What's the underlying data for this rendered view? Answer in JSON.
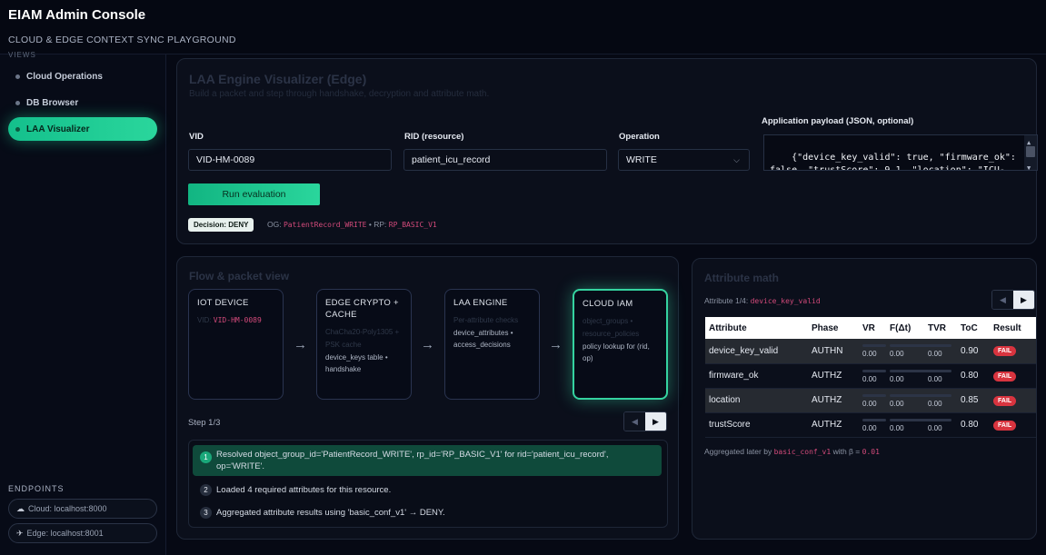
{
  "app": {
    "title": "EIAM Admin Console",
    "subtitle": "CLOUD & EDGE CONTEXT SYNC PLAYGROUND"
  },
  "sidebar": {
    "views_label": "VIEWS",
    "items": [
      {
        "label": "Cloud Operations"
      },
      {
        "label": "DB Browser"
      },
      {
        "label": "LAA Visualizer",
        "active": true
      }
    ],
    "endpoints_label": "ENDPOINTS",
    "endpoints": [
      {
        "icon": "cloud-icon",
        "glyph": "☁",
        "label": "Cloud: localhost:8000"
      },
      {
        "icon": "edge-icon",
        "glyph": "✈",
        "label": "Edge: localhost:8001"
      }
    ]
  },
  "engine": {
    "title": "LAA Engine Visualizer (Edge)",
    "subtitle": "Build a packet and step through handshake, decryption and attribute math.",
    "vid_label": "VID",
    "vid_value": "VID-HM-0089",
    "rid_label": "RID (resource)",
    "rid_value": "patient_icu_record",
    "op_label": "Operation",
    "op_value": "WRITE",
    "payload_label": "Application payload (JSON, optional)",
    "payload_value": "{\"device_key_valid\": true, \"firmware_ok\": false, \"trustScore\": 9.1, \"location\": \"ICU-",
    "run_label": "Run evaluation",
    "decision": "Decision: DENY",
    "og_prefix": "OG:",
    "og_value": "PatientRecord_WRITE",
    "rp_prefix": "• RP:",
    "rp_value": "RP_BASIC_V1"
  },
  "flow": {
    "title": "Flow & packet view",
    "stages": [
      {
        "title": "IOT DEVICE",
        "dim": "VID:",
        "code": "VID-HM-0089",
        "text": ""
      },
      {
        "title": "EDGE CRYPTO + CACHE",
        "dim": "ChaCha20-Poly1305 + PSK cache",
        "code": "",
        "text": "device_keys table • handshake"
      },
      {
        "title": "LAA ENGINE",
        "dim": "Per-attribute checks",
        "code": "",
        "text": "device_attributes • access_decisions"
      },
      {
        "title": "CLOUD IAM",
        "dim": "object_groups • resource_policies",
        "code": "",
        "text": "policy lookup for (rid, op)",
        "active": true
      }
    ],
    "arrow": "→",
    "step_label": "Step 1/3",
    "prev": "◀",
    "next": "▶",
    "steps": [
      {
        "num": "1",
        "text": "Resolved object_group_id='PatientRecord_WRITE', rp_id='RP_BASIC_V1' for rid='patient_icu_record', op='WRITE'.",
        "active": true
      },
      {
        "num": "2",
        "text": "Loaded 4 required attributes for this resource."
      },
      {
        "num": "3",
        "text": "Aggregated attribute results using 'basic_conf_v1' → DENY."
      }
    ]
  },
  "math": {
    "title": "Attribute math",
    "counter_prefix": "Attribute 1/4:",
    "counter_code": "device_key_valid",
    "prev": "◀",
    "next": "▶",
    "columns": [
      "Attribute",
      "Phase",
      "VR",
      "F(Δt)",
      "TVR",
      "ToC",
      "Result"
    ],
    "rows": [
      {
        "attribute": "device_key_valid",
        "phase": "AUTHN",
        "vr": "0.00",
        "f": "0.00",
        "tvr": "0.00",
        "toc": "0.90",
        "result": "FAIL",
        "highlight": true
      },
      {
        "attribute": "firmware_ok",
        "phase": "AUTHZ",
        "vr": "0.00",
        "f": "0.00",
        "tvr": "0.00",
        "toc": "0.80",
        "result": "FAIL"
      },
      {
        "attribute": "location",
        "phase": "AUTHZ",
        "vr": "0.00",
        "f": "0.00",
        "tvr": "0.00",
        "toc": "0.85",
        "result": "FAIL",
        "highlight": true
      },
      {
        "attribute": "trustScore",
        "phase": "AUTHZ",
        "vr": "0.00",
        "f": "0.00",
        "tvr": "0.00",
        "toc": "0.80",
        "result": "FAIL"
      }
    ],
    "agg_prefix": "Aggregated later by",
    "agg_code": "basic_conf_v1",
    "agg_mid": "with β =",
    "agg_beta": "0.01"
  }
}
